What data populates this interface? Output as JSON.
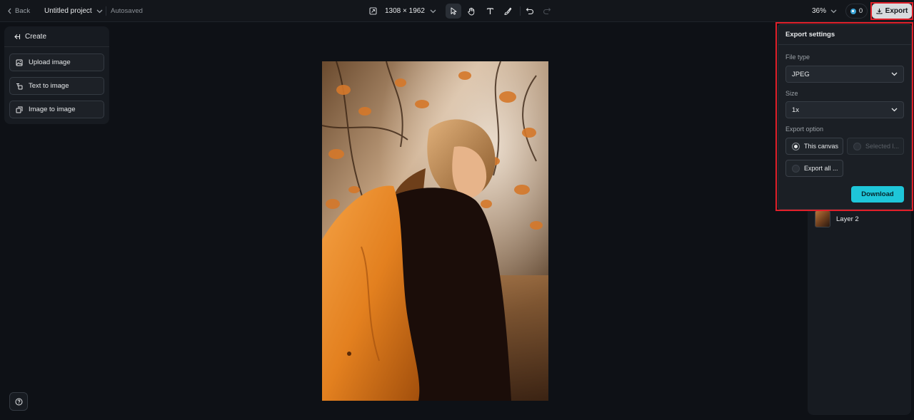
{
  "topbar": {
    "back_label": "Back",
    "project_name": "Untitled project",
    "autosave_status": "Autosaved",
    "canvas_size": "1308 × 1962",
    "zoom": "36%",
    "credits": "0",
    "export_label": "Export"
  },
  "create_panel": {
    "title": "Create",
    "buttons": [
      {
        "label": "Upload image",
        "icon": "upload-image-icon"
      },
      {
        "label": "Text to image",
        "icon": "text-to-image-icon"
      },
      {
        "label": "Image to image",
        "icon": "image-to-image-icon"
      }
    ]
  },
  "export_settings": {
    "title": "Export settings",
    "file_type_label": "File type",
    "file_type_value": "JPEG",
    "size_label": "Size",
    "size_value": "1x",
    "export_option_label": "Export option",
    "options": [
      {
        "label": "This canvas",
        "selected": true,
        "enabled": true
      },
      {
        "label": "Selected l...",
        "selected": false,
        "enabled": false
      },
      {
        "label": "Export all ...",
        "selected": false,
        "enabled": true
      }
    ],
    "download_label": "Download"
  },
  "layers": {
    "items": [
      {
        "label": "Layer 2"
      }
    ]
  },
  "colors": {
    "accent": "#1ec6d9",
    "highlight": "#e0202a",
    "background": "#0e1116"
  }
}
